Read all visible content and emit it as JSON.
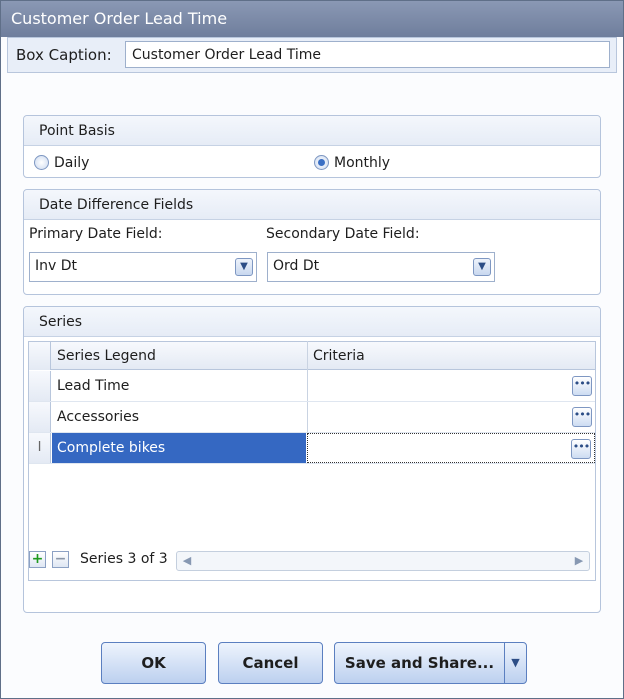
{
  "window": {
    "title": "Customer Order Lead Time"
  },
  "caption": {
    "label": "Box Caption:",
    "value": "Customer Order Lead Time"
  },
  "point_basis": {
    "header": "Point Basis",
    "options": [
      {
        "label": "Daily",
        "selected": false
      },
      {
        "label": "Monthly",
        "selected": true
      }
    ]
  },
  "date_fields": {
    "header": "Date Difference Fields",
    "primary_label": "Primary Date Field:",
    "primary_value": "Inv Dt",
    "secondary_label": "Secondary Date Field:",
    "secondary_value": "Ord Dt"
  },
  "series": {
    "header": "Series",
    "columns": [
      "Series Legend",
      "Criteria"
    ],
    "rows": [
      {
        "legend": "Lead Time",
        "criteria": ""
      },
      {
        "legend": "Accessories",
        "criteria": ""
      },
      {
        "legend": "Complete bikes",
        "criteria": ""
      }
    ],
    "selected_row_index": 2,
    "row_marker": "I",
    "ellipsis": "•••",
    "status": "Series 3 of 3",
    "add_symbol": "+",
    "remove_symbol": "−"
  },
  "buttons": {
    "ok": "OK",
    "cancel": "Cancel",
    "save_share": "Save and Share..."
  },
  "colors": {
    "title_bar": "#7d8baa",
    "selection": "#3568c2",
    "accent": "#5b7fc0"
  }
}
